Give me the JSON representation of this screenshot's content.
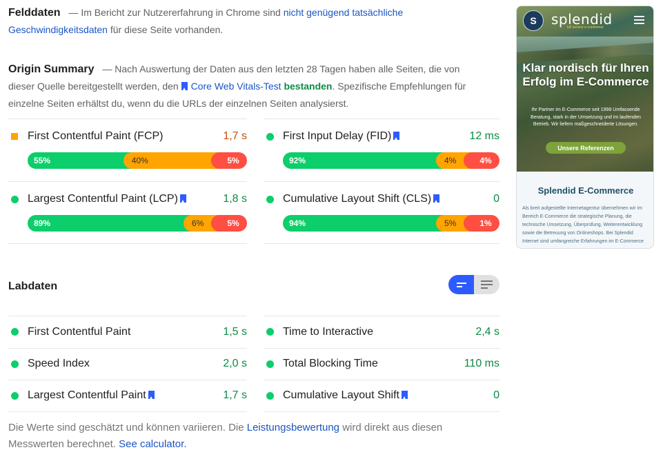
{
  "field_data": {
    "title": "Felddaten",
    "dash": "—",
    "text_before_link": "Im Bericht zur Nutzererfahrung in Chrome sind",
    "link_text": "nicht genügend tatsächliche Geschwindigkeitsdaten",
    "text_after_link": "für diese Seite vorhanden."
  },
  "origin_summary": {
    "title": "Origin Summary",
    "dash": "—",
    "text_before_link": "Nach Auswertung der Daten aus den letzten 28 Tagen haben alle Seiten, die von dieser Quelle bereitgestellt werden, den",
    "link_text": "Core Web Vitals-Test",
    "status_text": "bestanden",
    "text_after": ". Spezifische Empfehlungen für einzelne Seiten erhältst du, wenn du die URLs der einzelnen Seiten analysierst."
  },
  "field_metrics": [
    {
      "name": "First Contentful Paint (FCP)",
      "value": "1,7 s",
      "rating": "average",
      "core_vital": false,
      "distribution": {
        "good": "55%",
        "needs_improvement": "40%",
        "poor": "5%"
      },
      "distribution_values": [
        55,
        40,
        5
      ]
    },
    {
      "name": "First Input Delay (FID)",
      "value": "12 ms",
      "rating": "pass",
      "core_vital": true,
      "distribution": {
        "good": "92%",
        "needs_improvement": "4%",
        "poor": "4%"
      },
      "distribution_values": [
        92,
        4,
        4
      ]
    },
    {
      "name": "Largest Contentful Paint (LCP)",
      "value": "1,8 s",
      "rating": "pass",
      "core_vital": true,
      "distribution": {
        "good": "89%",
        "needs_improvement": "6%",
        "poor": "5%"
      },
      "distribution_values": [
        89,
        6,
        5
      ]
    },
    {
      "name": "Cumulative Layout Shift (CLS)",
      "value": "0",
      "rating": "pass",
      "core_vital": true,
      "distribution": {
        "good": "94%",
        "needs_improvement": "5%",
        "poor": "1%"
      },
      "distribution_values": [
        94,
        5,
        1
      ]
    }
  ],
  "lab_data": {
    "title": "Labdaten",
    "view_toggle": {
      "options": [
        "compact-view",
        "expanded-view"
      ],
      "selected": "compact-view"
    },
    "metrics": [
      {
        "name": "First Contentful Paint",
        "value": "1,5 s",
        "rating": "pass",
        "core_vital": false
      },
      {
        "name": "Time to Interactive",
        "value": "2,4 s",
        "rating": "pass",
        "core_vital": false
      },
      {
        "name": "Speed Index",
        "value": "2,0 s",
        "rating": "pass",
        "core_vital": false
      },
      {
        "name": "Total Blocking Time",
        "value": "110 ms",
        "rating": "pass",
        "core_vital": false
      },
      {
        "name": "Largest Contentful Paint",
        "value": "1,7 s",
        "rating": "pass",
        "core_vital": true
      },
      {
        "name": "Cumulative Layout Shift",
        "value": "0",
        "rating": "pass",
        "core_vital": true
      }
    ]
  },
  "footer": {
    "text_before_link": "Die Werte sind geschätzt und können variieren. Die",
    "link_text": "Leistungsbewertung",
    "text_middle": "wird direkt aus diesen Messwerten berechnet.",
    "calculator_link": "See calculator."
  },
  "screenshot_thumbnail": {
    "logo_letter": "S",
    "brand": "splendid",
    "brand_tagline": "full service e-commerce",
    "hero_title": "Klar nordisch für Ihren Erfolg im E-Commerce",
    "hero_text": "Ihr Partner im E-Commerce seit 1998 Umfassende Beratung, stark in der Umsetzung und im laufenden Betrieb. Wir liefern maßgeschneiderte Lösungen.",
    "hero_button": "Unsere Referenzen",
    "section_title": "Splendid E-Commerce",
    "section_text": "Als breit aufgestellte Internetagentur übernehmen wir im Bereich E-Commerce die strategische Planung, die technische Umsetzung, Überprüfung, Weiterentwicklung sowie die Betreuung von Onlineshops. Bei Splendid Internet sind umfangreiche Erfahrungen im E-Commerce"
  },
  "colors": {
    "pass": "#0cce6b",
    "pass_text": "#0c8a45",
    "average": "#ffa400",
    "average_text": "#c2510a",
    "fail": "#ff4e42",
    "link": "#1a55c4",
    "accent": "#2e5bff"
  }
}
